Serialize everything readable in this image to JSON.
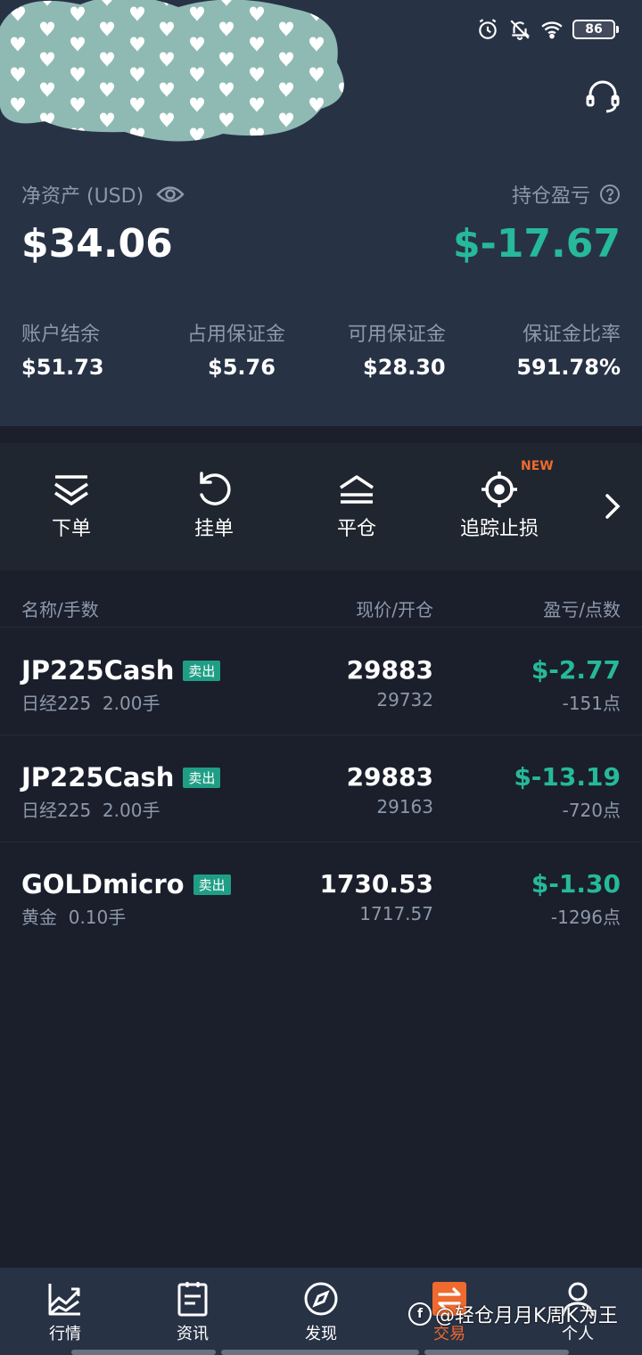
{
  "status_bar": {
    "battery": "86"
  },
  "account": {
    "net_assets_label": "净资产 (USD)",
    "net_assets_value": "$34.06",
    "position_pnl_label": "持仓盈亏",
    "position_pnl_value": "$-17.67",
    "metrics": [
      {
        "label": "账户结余",
        "value": "$51.73"
      },
      {
        "label": "占用保证金",
        "value": "$5.76"
      },
      {
        "label": "可用保证金",
        "value": "$28.30"
      },
      {
        "label": "保证金比率",
        "value": "591.78%"
      }
    ]
  },
  "actions": {
    "items": [
      {
        "label": "下单",
        "icon": "order-icon"
      },
      {
        "label": "挂单",
        "icon": "pending-order-icon"
      },
      {
        "label": "平仓",
        "icon": "close-position-icon"
      },
      {
        "label": "追踪止损",
        "icon": "trailing-stop-icon"
      }
    ],
    "new_badge": "NEW"
  },
  "table": {
    "headers": {
      "name": "名称/手数",
      "price": "现价/开仓",
      "pnl": "盈亏/点数"
    },
    "rows": [
      {
        "symbol": "JP225Cash",
        "side": "卖出",
        "name": "日经225",
        "lots": "2.00手",
        "price": "29883",
        "open": "29732",
        "pnl": "$-2.77",
        "points": "-151点"
      },
      {
        "symbol": "JP225Cash",
        "side": "卖出",
        "name": "日经225",
        "lots": "2.00手",
        "price": "29883",
        "open": "29163",
        "pnl": "$-13.19",
        "points": "-720点"
      },
      {
        "symbol": "GOLDmicro",
        "side": "卖出",
        "name": "黄金",
        "lots": "0.10手",
        "price": "1730.53",
        "open": "1717.57",
        "pnl": "$-1.30",
        "points": "-1296点"
      }
    ]
  },
  "bottom_nav": {
    "items": [
      {
        "label": "行情",
        "icon": "market-chart-icon"
      },
      {
        "label": "资讯",
        "icon": "news-icon"
      },
      {
        "label": "发现",
        "icon": "compass-icon"
      },
      {
        "label": "交易",
        "icon": "trade-icon",
        "active": true
      },
      {
        "label": "个人",
        "icon": "profile-icon"
      }
    ]
  },
  "watermark": "@轻仓月月K周K为王",
  "colors": {
    "accent_green": "#26b99a",
    "accent_orange": "#ef6a2e",
    "header_bg": "#283245",
    "page_bg": "#1a1f2b"
  }
}
